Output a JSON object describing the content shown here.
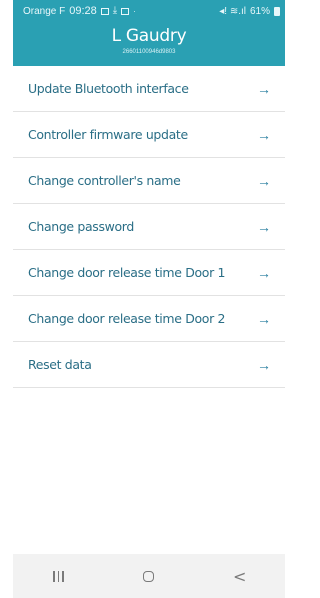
{
  "status_bar": {
    "carrier": "Orange F",
    "time": "09:28",
    "dot": "·",
    "signal": "◂! ≋.ıl",
    "battery_percent": "61%"
  },
  "header": {
    "title": "L Gaudry",
    "subtitle": "26601100946d9803"
  },
  "menu": {
    "items": [
      {
        "label": "Update Bluetooth interface",
        "arrow": "→"
      },
      {
        "label": "Controller firmware update",
        "arrow": "→"
      },
      {
        "label": "Change controller's name",
        "arrow": "→"
      },
      {
        "label": "Change password",
        "arrow": "→"
      },
      {
        "label": "Change door release time Door 1",
        "arrow": "→"
      },
      {
        "label": "Change door release time Door 2",
        "arrow": "→"
      },
      {
        "label": "Reset data",
        "arrow": "→"
      }
    ]
  },
  "nav": {
    "back_glyph": "<"
  },
  "colors": {
    "header_bg": "#2aa0b3",
    "menu_text": "#2a6e86"
  }
}
